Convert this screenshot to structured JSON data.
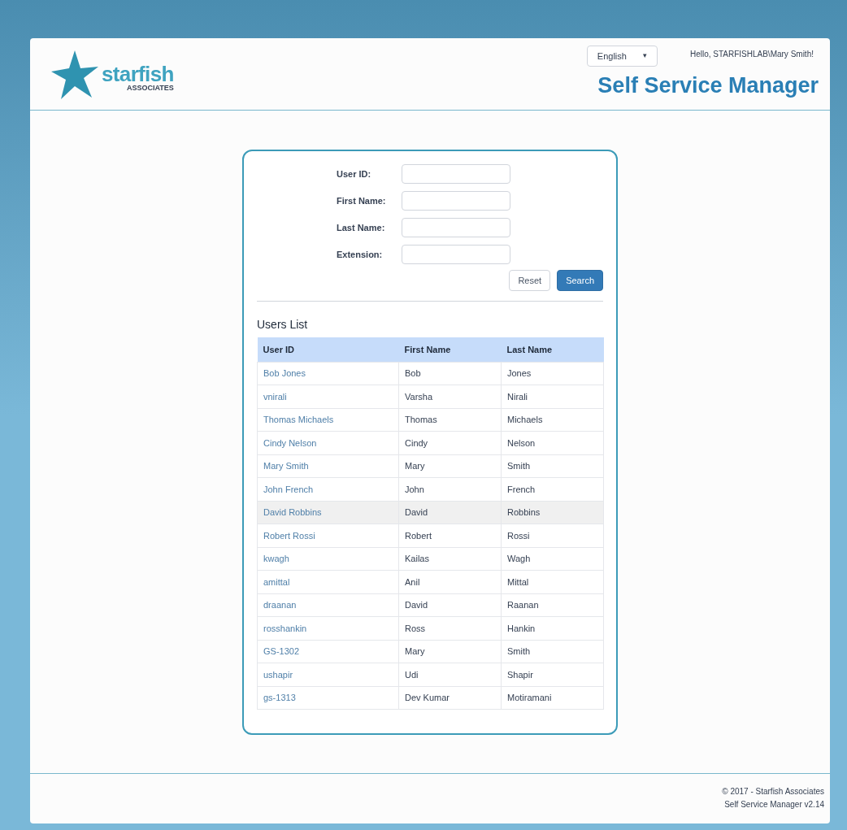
{
  "logo": {
    "word": "starfish",
    "subtitle": "ASSOCIATES"
  },
  "language_select": {
    "value": "English",
    "caret": "▾"
  },
  "greeting": "Hello, STARFISHLAB\\Mary Smith!",
  "app_title": "Self Service Manager",
  "search_form": {
    "fields": [
      {
        "label": "User ID:"
      },
      {
        "label": "First Name:"
      },
      {
        "label": "Last Name:"
      },
      {
        "label": "Extension:"
      }
    ],
    "buttons": [
      {
        "label": "Reset",
        "kind": "default"
      },
      {
        "label": "Search",
        "kind": "primary"
      }
    ]
  },
  "users_list": {
    "title": "Users List",
    "columns": [
      "User ID",
      "First Name",
      "Last Name"
    ],
    "rows": [
      {
        "user_id": "Bob Jones",
        "first_name": "Bob",
        "last_name": "Jones",
        "hovered": false
      },
      {
        "user_id": "vnirali",
        "first_name": "Varsha",
        "last_name": "Nirali",
        "hovered": false
      },
      {
        "user_id": "Thomas Michaels",
        "first_name": "Thomas",
        "last_name": "Michaels",
        "hovered": false
      },
      {
        "user_id": "Cindy Nelson",
        "first_name": "Cindy",
        "last_name": "Nelson",
        "hovered": false
      },
      {
        "user_id": "Mary Smith",
        "first_name": "Mary",
        "last_name": "Smith",
        "hovered": false
      },
      {
        "user_id": "John French",
        "first_name": "John",
        "last_name": "French",
        "hovered": false
      },
      {
        "user_id": "David Robbins",
        "first_name": "David",
        "last_name": "Robbins",
        "hovered": true
      },
      {
        "user_id": "Robert Rossi",
        "first_name": "Robert",
        "last_name": "Rossi",
        "hovered": false
      },
      {
        "user_id": "kwagh",
        "first_name": "Kailas",
        "last_name": "Wagh",
        "hovered": false
      },
      {
        "user_id": "amittal",
        "first_name": "Anil",
        "last_name": "Mittal",
        "hovered": false
      },
      {
        "user_id": "draanan",
        "first_name": "David",
        "last_name": "Raanan",
        "hovered": false
      },
      {
        "user_id": "rosshankin",
        "first_name": "Ross",
        "last_name": "Hankin",
        "hovered": false
      },
      {
        "user_id": "GS-1302",
        "first_name": "Mary",
        "last_name": "Smith",
        "hovered": false
      },
      {
        "user_id": "ushapir",
        "first_name": "Udi",
        "last_name": "Shapir",
        "hovered": false
      },
      {
        "user_id": "gs-1313",
        "first_name": "Dev Kumar",
        "last_name": "Motiramani",
        "hovered": false
      }
    ]
  },
  "footer": {
    "copyright": "© 2017 - Starfish Associates",
    "version": "Self Service Manager v2.14"
  }
}
